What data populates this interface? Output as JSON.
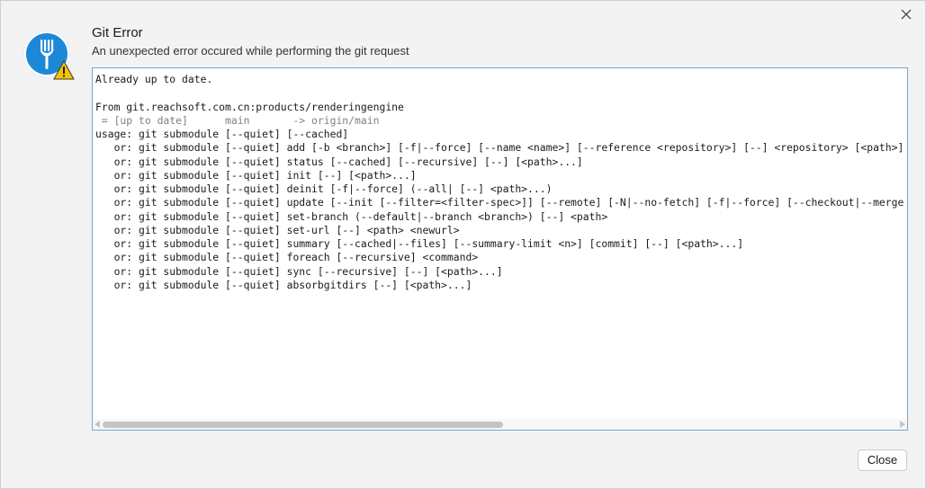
{
  "dialog": {
    "title": "Git Error",
    "subtitle": "An unexpected error occured while performing the git request",
    "close_icon": "close-icon",
    "app_icon": "fork-icon",
    "warning_icon": "warning-icon",
    "close_button_label": "Close",
    "colors": {
      "icon_blue": "#1e88d8",
      "warning_yellow": "#f5c400",
      "border_blue": "#6fa8d6"
    }
  },
  "output": {
    "lines": [
      {
        "text": "Already up to date.",
        "dim": false
      },
      {
        "text": "",
        "dim": false
      },
      {
        "text": "From git.reachsoft.com.cn:products/renderingengine",
        "dim": false
      },
      {
        "text": " = [up to date]      main       -> origin/main",
        "dim": true
      },
      {
        "text": "usage: git submodule [--quiet] [--cached]",
        "dim": false
      },
      {
        "text": "   or: git submodule [--quiet] add [-b <branch>] [-f|--force] [--name <name>] [--reference <repository>] [--] <repository> [<path>]",
        "dim": false
      },
      {
        "text": "   or: git submodule [--quiet] status [--cached] [--recursive] [--] [<path>...]",
        "dim": false
      },
      {
        "text": "   or: git submodule [--quiet] init [--] [<path>...]",
        "dim": false
      },
      {
        "text": "   or: git submodule [--quiet] deinit [-f|--force] (--all| [--] <path>...)",
        "dim": false
      },
      {
        "text": "   or: git submodule [--quiet] update [--init [--filter=<filter-spec>]] [--remote] [-N|--no-fetch] [-f|--force] [--checkout|--merge|--rebase]",
        "dim": false
      },
      {
        "text": "   or: git submodule [--quiet] set-branch (--default|--branch <branch>) [--] <path>",
        "dim": false
      },
      {
        "text": "   or: git submodule [--quiet] set-url [--] <path> <newurl>",
        "dim": false
      },
      {
        "text": "   or: git submodule [--quiet] summary [--cached|--files] [--summary-limit <n>] [commit] [--] [<path>...]",
        "dim": false
      },
      {
        "text": "   or: git submodule [--quiet] foreach [--recursive] <command>",
        "dim": false
      },
      {
        "text": "   or: git submodule [--quiet] sync [--recursive] [--] [<path>...]",
        "dim": false
      },
      {
        "text": "   or: git submodule [--quiet] absorbgitdirs [--] [<path>...]",
        "dim": false
      }
    ]
  }
}
